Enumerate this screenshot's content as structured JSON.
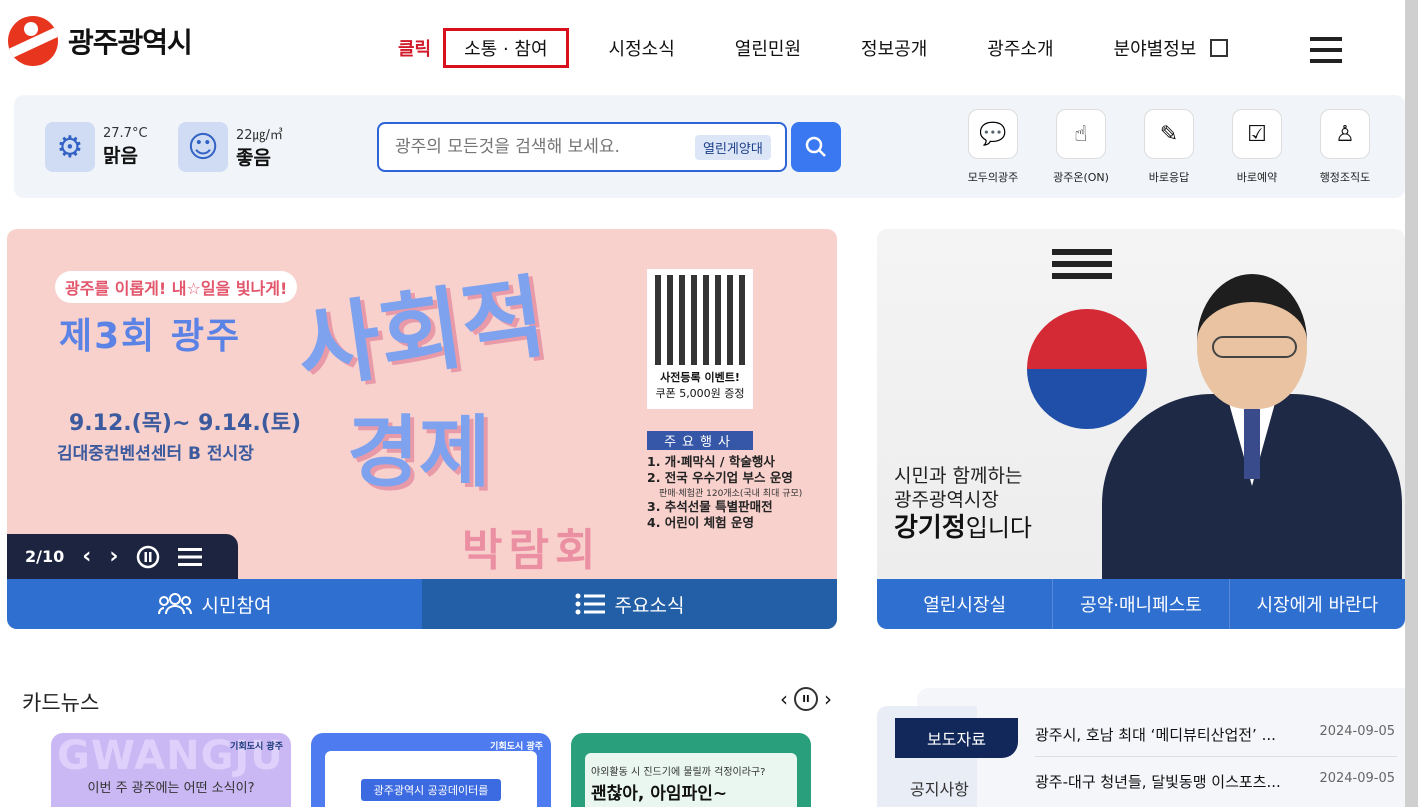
{
  "header": {
    "logo_text": "광주광역시",
    "click_label": "클릭",
    "nav": [
      "소통 · 참여",
      "시정소식",
      "열린민원",
      "정보공개",
      "광주소개",
      "분야별정보"
    ]
  },
  "weather": {
    "temp": "27.7°C",
    "condition": "맑음",
    "dust": "22㎍/㎥",
    "dust_status": "좋음"
  },
  "search": {
    "placeholder": "광주의 모든것을 검색해 보세요.",
    "tag": "열린게양대"
  },
  "quick_links": [
    "모두의광주",
    "광주온(ON)",
    "바로응답",
    "바로예약",
    "행정조직도"
  ],
  "banner": {
    "pill": "광주를 이롭게! 내☆일을 빛나게!",
    "title": "제3회 광주",
    "big1": "사회적",
    "big2": "경제",
    "big3": "박람회",
    "date": "9.12.(목)~ 9.14.(토)",
    "venue": "김대중컨벤션센터 B 전시장",
    "qr_title": "사전등록 이벤트!",
    "qr_sub": "쿠폰 5,000원 증정",
    "events_head": "주요행사",
    "events": [
      "1. 개·폐막식 / 학술행사",
      "2. 전국 우수기업 부스 운영",
      "3. 추석선물 특별판매전",
      "4. 어린이 체험 운영"
    ],
    "events_note": "판매·체험관 120개소(국내 최대 규모)",
    "counter": "2/10",
    "tab1": "시민참여",
    "tab2": "주요소식"
  },
  "mayor": {
    "line1": "시민과 함께하는",
    "line2": "광주광역시장",
    "name": "강기정",
    "suffix": "입니다",
    "tabs": [
      "열린시장실",
      "공약·매니페스토",
      "시장에게 바란다"
    ]
  },
  "card_news": {
    "title": "카드뉴스",
    "card1_bg": "GWANGJU",
    "card1_text": "이번 주 광주에는 어떤 소식이?",
    "card1_brand": "기회도시 광주",
    "card2_pill": "광주광역시 공공데이터를",
    "card2_brand": "기회도시 광주",
    "card3_text": "야외활동 시 진드기에 물릴까 걱정이라구?",
    "card3_title": "괜찮아, 아임파인~"
  },
  "press": {
    "tab_active": "보도자료",
    "tab2": "공지사항",
    "items": [
      {
        "title": "광주시, 호남 최대 ‘메디뷰티산업전’ ...",
        "date": "2024-09-05"
      },
      {
        "title": "광주-대구 청년들, 달빛동맹 이스포츠...",
        "date": "2024-09-05"
      }
    ]
  }
}
